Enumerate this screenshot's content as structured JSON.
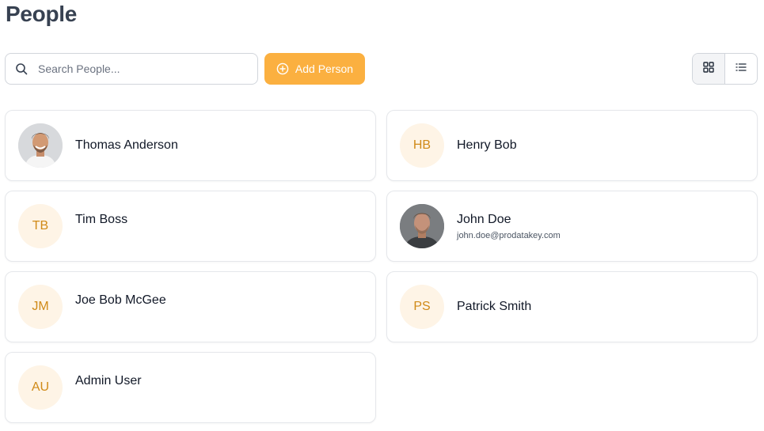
{
  "page": {
    "title": "People"
  },
  "search": {
    "placeholder": "Search People...",
    "value": "",
    "icon": "search-icon"
  },
  "add_button": {
    "label": "Add Person",
    "icon": "plus-circle-icon",
    "color": "#fbb040"
  },
  "view_toggle": {
    "active": "grid",
    "options": [
      "grid",
      "list"
    ]
  },
  "people": [
    {
      "name": "Thomas Anderson",
      "avatar": "photo"
    },
    {
      "name": "Henry Bob",
      "initials": "HB"
    },
    {
      "name": "Tim Boss",
      "initials": "TB"
    },
    {
      "name": "John Doe",
      "avatar": "photo",
      "email": "john.doe@prodatakey.com"
    },
    {
      "name": "Joe Bob McGee",
      "initials": "JM"
    },
    {
      "name": "Patrick Smith",
      "initials": "PS"
    },
    {
      "name": "Admin User",
      "initials": "AU"
    }
  ],
  "colors": {
    "accent": "#fbb040",
    "initials_bg": "#fef4e6",
    "initials_text": "#d08a18"
  }
}
